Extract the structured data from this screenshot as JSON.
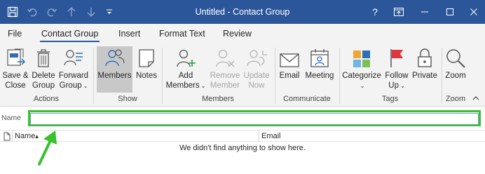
{
  "window": {
    "title": "Untitled  -  Contact Group",
    "title_bar_color": "#2b579a"
  },
  "quick_access": [
    {
      "name": "save-icon",
      "interactable": true
    },
    {
      "name": "undo-icon",
      "interactable": true
    },
    {
      "name": "redo-icon",
      "interactable": true
    },
    {
      "name": "up-arrow-icon",
      "interactable": true
    },
    {
      "name": "down-arrow-icon",
      "interactable": true
    },
    {
      "name": "customize-toolbar-icon",
      "interactable": true
    }
  ],
  "window_controls": [
    "help-icon",
    "ribbon-display-options-icon",
    "minimize-icon",
    "maximize-icon",
    "close-icon"
  ],
  "menu": {
    "tabs": [
      {
        "label": "File"
      },
      {
        "label": "Contact Group",
        "active": true
      },
      {
        "label": "Insert"
      },
      {
        "label": "Format Text"
      },
      {
        "label": "Review"
      }
    ]
  },
  "ribbon": {
    "groups": {
      "actions": "Actions",
      "show": "Show",
      "members": "Members",
      "communicate": "Communicate",
      "tags": "Tags",
      "zoom": "Zoom"
    },
    "buttons": {
      "save_close": {
        "line1": "Save &",
        "line2": "Close"
      },
      "delete_group": {
        "line1": "Delete",
        "line2": "Group"
      },
      "forward_group": {
        "line1": "Forward",
        "line2": "Group"
      },
      "members": {
        "line1": "Members"
      },
      "notes": {
        "line1": "Notes"
      },
      "add_members": {
        "line1": "Add",
        "line2": "Members"
      },
      "remove_member": {
        "line1": "Remove",
        "line2": "Member"
      },
      "update_now": {
        "line1": "Update",
        "line2": "Now"
      },
      "email": {
        "line1": "Email"
      },
      "meeting": {
        "line1": "Meeting"
      },
      "categorize": {
        "line1": "Categorize"
      },
      "follow_up": {
        "line1": "Follow",
        "line2": "Up"
      },
      "private": {
        "line1": "Private"
      },
      "zoom": {
        "line1": "Zoom"
      }
    }
  },
  "name_field": {
    "label": "Name",
    "value": "",
    "highlight_color": "#39c12f"
  },
  "member_list": {
    "columns": [
      "Name",
      "Email"
    ],
    "sort_indicator": "▴",
    "empty_message": "We didn't find anything to show here."
  },
  "annotation": {
    "arrow_color": "#39c12f"
  }
}
